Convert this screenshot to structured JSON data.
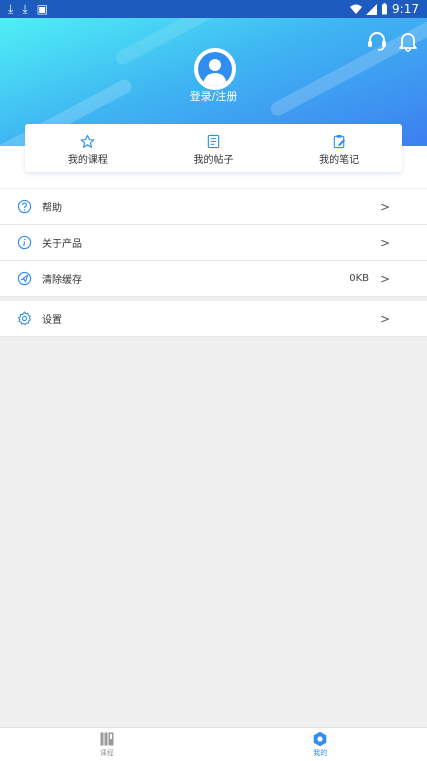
{
  "status_bar": {
    "time": "9:17"
  },
  "header": {
    "login_label": "登录/注册"
  },
  "quick_links": [
    {
      "label": "我的课程",
      "icon": "star-icon"
    },
    {
      "label": "我的帖子",
      "icon": "document-icon"
    },
    {
      "label": "我的笔记",
      "icon": "notepad-icon"
    }
  ],
  "menu": {
    "help": {
      "label": "帮助"
    },
    "about": {
      "label": "关于产品"
    },
    "clear_cache": {
      "label": "清除缓存",
      "value": "0KB"
    },
    "settings": {
      "label": "设置"
    },
    "arrow": ">"
  },
  "tabbar": {
    "tabs": [
      {
        "label": "课程",
        "active": false
      },
      {
        "label": "我的",
        "active": true
      }
    ]
  },
  "colors": {
    "accent": "#2f8ef0",
    "status_bar": "#1e5bbf",
    "inactive": "#9a9a9a"
  }
}
